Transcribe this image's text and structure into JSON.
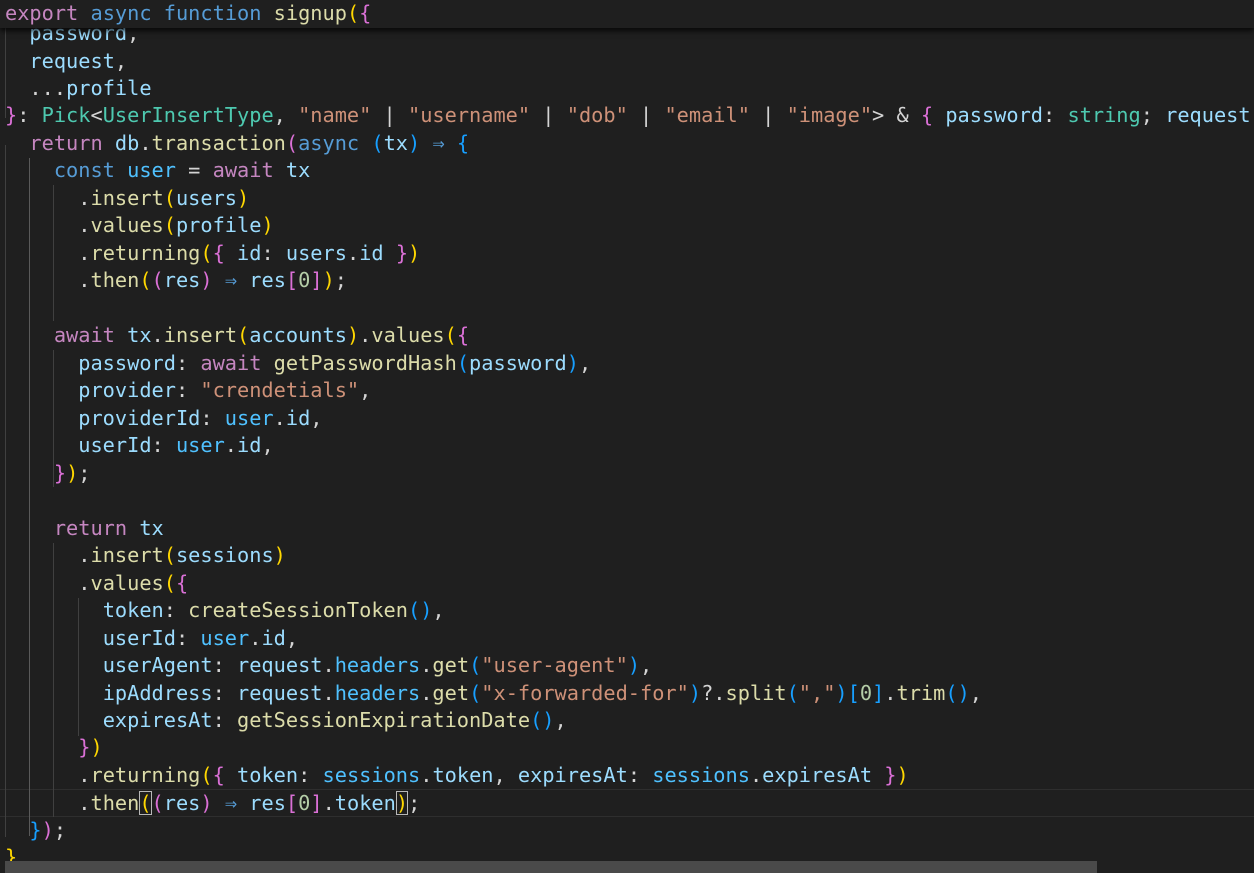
{
  "editor": {
    "language": "TypeScript",
    "function_name": "signup"
  },
  "code": {
    "lines": [
      [
        [
          "export",
          "t-ctl"
        ],
        [
          " ",
          ""
        ],
        [
          "async",
          "t-kw"
        ],
        [
          " ",
          ""
        ],
        [
          "function",
          "t-kw"
        ],
        [
          " ",
          ""
        ],
        [
          "signup",
          "t-fn"
        ],
        [
          "(",
          "t-b1"
        ],
        [
          "{",
          "t-b2"
        ]
      ],
      [
        [
          "  ",
          ""
        ],
        [
          "password",
          "t-var"
        ],
        [
          ",",
          "t-pun"
        ]
      ],
      [
        [
          "  ",
          ""
        ],
        [
          "request",
          "t-var"
        ],
        [
          ",",
          "t-pun"
        ]
      ],
      [
        [
          "  ",
          ""
        ],
        [
          "...",
          "t-pun"
        ],
        [
          "profile",
          "t-var"
        ]
      ],
      [
        [
          "}",
          "t-b2"
        ],
        [
          ": ",
          "t-pun"
        ],
        [
          "Pick",
          "t-type"
        ],
        [
          "<",
          "t-pun"
        ],
        [
          "UserInsertType",
          "t-type"
        ],
        [
          ", ",
          "t-pun"
        ],
        [
          "\"name\"",
          "t-str"
        ],
        [
          " | ",
          "t-pun"
        ],
        [
          "\"username\"",
          "t-str"
        ],
        [
          " | ",
          "t-pun"
        ],
        [
          "\"dob\"",
          "t-str"
        ],
        [
          " | ",
          "t-pun"
        ],
        [
          "\"email\"",
          "t-str"
        ],
        [
          " | ",
          "t-pun"
        ],
        [
          "\"image\"",
          "t-str"
        ],
        [
          "> & ",
          "t-pun"
        ],
        [
          "{",
          "t-b2"
        ],
        [
          " ",
          ""
        ],
        [
          "password",
          "t-var"
        ],
        [
          ": ",
          "t-pun"
        ],
        [
          "string",
          "t-type"
        ],
        [
          "; ",
          "t-pun"
        ],
        [
          "request",
          "t-var"
        ]
      ],
      [
        [
          "  ",
          ""
        ],
        [
          "return",
          "t-ctl"
        ],
        [
          " ",
          ""
        ],
        [
          "db",
          "t-var"
        ],
        [
          ".",
          "t-pun"
        ],
        [
          "transaction",
          "t-fn"
        ],
        [
          "(",
          "t-b2"
        ],
        [
          "async",
          "t-kw"
        ],
        [
          " ",
          ""
        ],
        [
          "(",
          "t-b3"
        ],
        [
          "tx",
          "t-var"
        ],
        [
          ")",
          "t-b3"
        ],
        [
          " ",
          ""
        ],
        [
          "⇒",
          "t-kw"
        ],
        [
          " ",
          ""
        ],
        [
          "{",
          "t-b3"
        ]
      ],
      [
        [
          "    ",
          ""
        ],
        [
          "const",
          "t-kw"
        ],
        [
          " ",
          ""
        ],
        [
          "user",
          "t-const"
        ],
        [
          " = ",
          "t-pun"
        ],
        [
          "await",
          "t-ctl"
        ],
        [
          " ",
          ""
        ],
        [
          "tx",
          "t-var"
        ]
      ],
      [
        [
          "      ",
          ""
        ],
        [
          ".",
          "t-pun"
        ],
        [
          "insert",
          "t-fn"
        ],
        [
          "(",
          "t-b1"
        ],
        [
          "users",
          "t-var"
        ],
        [
          ")",
          "t-b1"
        ]
      ],
      [
        [
          "      ",
          ""
        ],
        [
          ".",
          "t-pun"
        ],
        [
          "values",
          "t-fn"
        ],
        [
          "(",
          "t-b1"
        ],
        [
          "profile",
          "t-var"
        ],
        [
          ")",
          "t-b1"
        ]
      ],
      [
        [
          "      ",
          ""
        ],
        [
          ".",
          "t-pun"
        ],
        [
          "returning",
          "t-fn"
        ],
        [
          "(",
          "t-b1"
        ],
        [
          "{",
          "t-b2"
        ],
        [
          " ",
          ""
        ],
        [
          "id",
          "t-var"
        ],
        [
          ": ",
          "t-pun"
        ],
        [
          "users",
          "t-var"
        ],
        [
          ".",
          "t-pun"
        ],
        [
          "id",
          "t-var"
        ],
        [
          " ",
          ""
        ],
        [
          "}",
          "t-b2"
        ],
        [
          ")",
          "t-b1"
        ]
      ],
      [
        [
          "      ",
          ""
        ],
        [
          ".",
          "t-pun"
        ],
        [
          "then",
          "t-fn"
        ],
        [
          "(",
          "t-b1"
        ],
        [
          "(",
          "t-b2"
        ],
        [
          "res",
          "t-var"
        ],
        [
          ")",
          "t-b2"
        ],
        [
          " ",
          ""
        ],
        [
          "⇒",
          "t-kw"
        ],
        [
          " ",
          ""
        ],
        [
          "res",
          "t-var"
        ],
        [
          "[",
          "t-b2"
        ],
        [
          "0",
          "t-num"
        ],
        [
          "]",
          "t-b2"
        ],
        [
          ")",
          "t-b1"
        ],
        [
          ";",
          "t-pun"
        ]
      ],
      [],
      [
        [
          "    ",
          ""
        ],
        [
          "await",
          "t-ctl"
        ],
        [
          " ",
          ""
        ],
        [
          "tx",
          "t-var"
        ],
        [
          ".",
          "t-pun"
        ],
        [
          "insert",
          "t-fn"
        ],
        [
          "(",
          "t-b1"
        ],
        [
          "accounts",
          "t-var"
        ],
        [
          ")",
          "t-b1"
        ],
        [
          ".",
          "t-pun"
        ],
        [
          "values",
          "t-fn"
        ],
        [
          "(",
          "t-b1"
        ],
        [
          "{",
          "t-b2"
        ]
      ],
      [
        [
          "      ",
          ""
        ],
        [
          "password",
          "t-var"
        ],
        [
          ": ",
          "t-pun"
        ],
        [
          "await",
          "t-ctl"
        ],
        [
          " ",
          ""
        ],
        [
          "getPasswordHash",
          "t-fn"
        ],
        [
          "(",
          "t-b3"
        ],
        [
          "password",
          "t-var"
        ],
        [
          ")",
          "t-b3"
        ],
        [
          ",",
          "t-pun"
        ]
      ],
      [
        [
          "      ",
          ""
        ],
        [
          "provider",
          "t-var"
        ],
        [
          ": ",
          "t-pun"
        ],
        [
          "\"crendetials\"",
          "t-str"
        ],
        [
          ",",
          "t-pun"
        ]
      ],
      [
        [
          "      ",
          ""
        ],
        [
          "providerId",
          "t-var"
        ],
        [
          ": ",
          "t-pun"
        ],
        [
          "user",
          "t-const"
        ],
        [
          ".",
          "t-pun"
        ],
        [
          "id",
          "t-var"
        ],
        [
          ",",
          "t-pun"
        ]
      ],
      [
        [
          "      ",
          ""
        ],
        [
          "userId",
          "t-var"
        ],
        [
          ": ",
          "t-pun"
        ],
        [
          "user",
          "t-const"
        ],
        [
          ".",
          "t-pun"
        ],
        [
          "id",
          "t-var"
        ],
        [
          ",",
          "t-pun"
        ]
      ],
      [
        [
          "    ",
          ""
        ],
        [
          "}",
          "t-b2"
        ],
        [
          ")",
          "t-b1"
        ],
        [
          ";",
          "t-pun"
        ]
      ],
      [],
      [
        [
          "    ",
          ""
        ],
        [
          "return",
          "t-ctl"
        ],
        [
          " ",
          ""
        ],
        [
          "tx",
          "t-var"
        ]
      ],
      [
        [
          "      ",
          ""
        ],
        [
          ".",
          "t-pun"
        ],
        [
          "insert",
          "t-fn"
        ],
        [
          "(",
          "t-b1"
        ],
        [
          "sessions",
          "t-var"
        ],
        [
          ")",
          "t-b1"
        ]
      ],
      [
        [
          "      ",
          ""
        ],
        [
          ".",
          "t-pun"
        ],
        [
          "values",
          "t-fn"
        ],
        [
          "(",
          "t-b1"
        ],
        [
          "{",
          "t-b2"
        ]
      ],
      [
        [
          "        ",
          ""
        ],
        [
          "token",
          "t-var"
        ],
        [
          ": ",
          "t-pun"
        ],
        [
          "createSessionToken",
          "t-fn"
        ],
        [
          "(",
          "t-b3"
        ],
        [
          ")",
          "t-b3"
        ],
        [
          ",",
          "t-pun"
        ]
      ],
      [
        [
          "        ",
          ""
        ],
        [
          "userId",
          "t-var"
        ],
        [
          ": ",
          "t-pun"
        ],
        [
          "user",
          "t-const"
        ],
        [
          ".",
          "t-pun"
        ],
        [
          "id",
          "t-var"
        ],
        [
          ",",
          "t-pun"
        ]
      ],
      [
        [
          "        ",
          ""
        ],
        [
          "userAgent",
          "t-var"
        ],
        [
          ": ",
          "t-pun"
        ],
        [
          "request",
          "t-var"
        ],
        [
          ".",
          "t-pun"
        ],
        [
          "headers",
          "t-const"
        ],
        [
          ".",
          "t-pun"
        ],
        [
          "get",
          "t-fn"
        ],
        [
          "(",
          "t-b3"
        ],
        [
          "\"user-agent\"",
          "t-str"
        ],
        [
          ")",
          "t-b3"
        ],
        [
          ",",
          "t-pun"
        ]
      ],
      [
        [
          "        ",
          ""
        ],
        [
          "ipAddress",
          "t-var"
        ],
        [
          ": ",
          "t-pun"
        ],
        [
          "request",
          "t-var"
        ],
        [
          ".",
          "t-pun"
        ],
        [
          "headers",
          "t-const"
        ],
        [
          ".",
          "t-pun"
        ],
        [
          "get",
          "t-fn"
        ],
        [
          "(",
          "t-b3"
        ],
        [
          "\"x-forwarded-for\"",
          "t-str"
        ],
        [
          ")",
          "t-b3"
        ],
        [
          "?.",
          "t-pun"
        ],
        [
          "split",
          "t-fn"
        ],
        [
          "(",
          "t-b3"
        ],
        [
          "\",\"",
          "t-str"
        ],
        [
          ")",
          "t-b3"
        ],
        [
          "[",
          "t-b3"
        ],
        [
          "0",
          "t-num"
        ],
        [
          "]",
          "t-b3"
        ],
        [
          ".",
          "t-pun"
        ],
        [
          "trim",
          "t-fn"
        ],
        [
          "(",
          "t-b3"
        ],
        [
          ")",
          "t-b3"
        ],
        [
          ",",
          "t-pun"
        ]
      ],
      [
        [
          "        ",
          ""
        ],
        [
          "expiresAt",
          "t-var"
        ],
        [
          ": ",
          "t-pun"
        ],
        [
          "getSessionExpirationDate",
          "t-fn"
        ],
        [
          "(",
          "t-b3"
        ],
        [
          ")",
          "t-b3"
        ],
        [
          ",",
          "t-pun"
        ]
      ],
      [
        [
          "      ",
          ""
        ],
        [
          "}",
          "t-b2"
        ],
        [
          ")",
          "t-b1"
        ]
      ],
      [
        [
          "      ",
          ""
        ],
        [
          ".",
          "t-pun"
        ],
        [
          "returning",
          "t-fn"
        ],
        [
          "(",
          "t-b1"
        ],
        [
          "{",
          "t-b2"
        ],
        [
          " ",
          ""
        ],
        [
          "token",
          "t-var"
        ],
        [
          ": ",
          "t-pun"
        ],
        [
          "sessions",
          "t-const"
        ],
        [
          ".",
          "t-pun"
        ],
        [
          "token",
          "t-var"
        ],
        [
          ", ",
          "t-pun"
        ],
        [
          "expiresAt",
          "t-var"
        ],
        [
          ": ",
          "t-pun"
        ],
        [
          "sessions",
          "t-const"
        ],
        [
          ".",
          "t-pun"
        ],
        [
          "expiresAt",
          "t-var"
        ],
        [
          " ",
          ""
        ],
        [
          "}",
          "t-b2"
        ],
        [
          ")",
          "t-b1"
        ]
      ],
      [
        [
          "      ",
          ""
        ],
        [
          ".",
          "t-pun"
        ],
        [
          "then",
          "t-fn"
        ],
        [
          "(",
          "t-b1 t-hl"
        ],
        [
          "(",
          "t-b2"
        ],
        [
          "res",
          "t-var"
        ],
        [
          ")",
          "t-b2"
        ],
        [
          " ",
          ""
        ],
        [
          "⇒",
          "t-kw"
        ],
        [
          " ",
          ""
        ],
        [
          "res",
          "t-var"
        ],
        [
          "[",
          "t-b2"
        ],
        [
          "0",
          "t-num"
        ],
        [
          "]",
          "t-b2"
        ],
        [
          ".",
          "t-pun"
        ],
        [
          "token",
          "t-var"
        ],
        [
          ")",
          "t-b1 t-hl"
        ],
        [
          ";",
          "t-pun"
        ]
      ],
      [
        [
          "  ",
          ""
        ],
        [
          "}",
          "t-b3"
        ],
        [
          ")",
          "t-b2"
        ],
        [
          ";",
          "t-pun"
        ]
      ],
      [
        [
          "}",
          "t-b1"
        ]
      ]
    ]
  }
}
